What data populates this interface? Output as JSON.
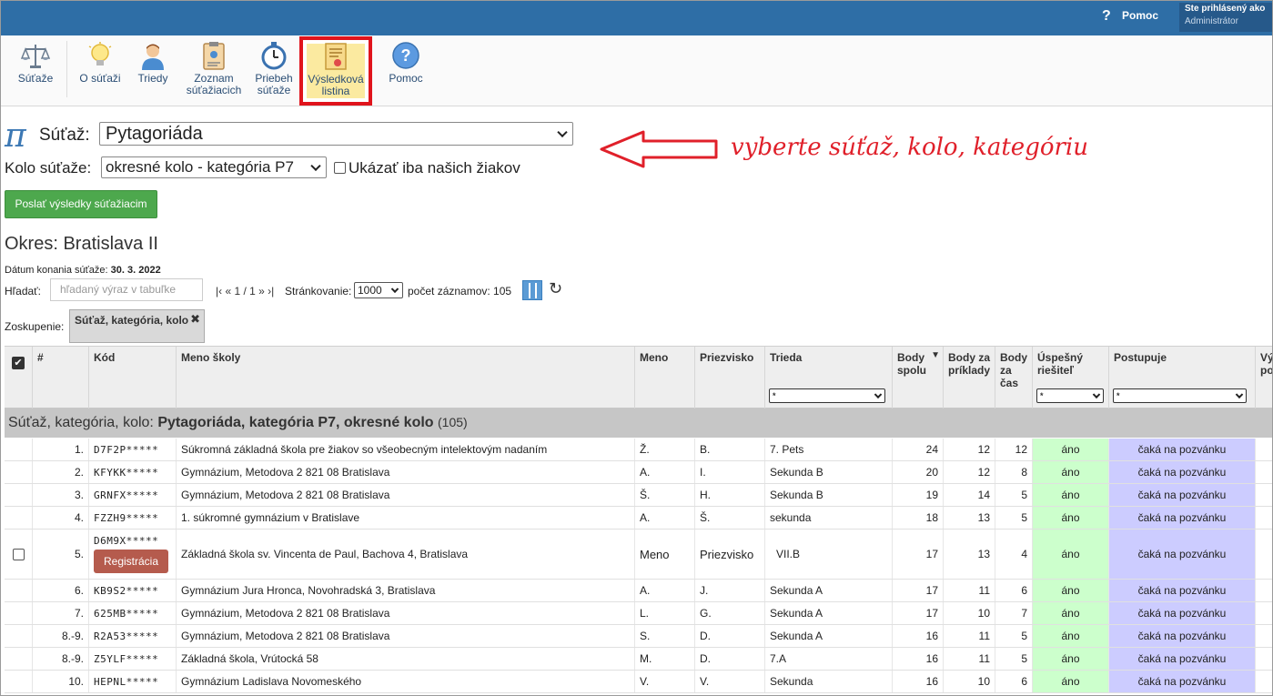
{
  "topbar": {
    "help_icon": "?",
    "help_label": "Pomoc",
    "logged_in_label": "Ste prihlásený ako",
    "user_name": "Administrátor"
  },
  "toolbar": {
    "items": [
      {
        "label": "Súťaže",
        "icon": "scales-icon"
      },
      {
        "label": "O súťaži",
        "icon": "lightbulb-icon"
      },
      {
        "label": "Triedy",
        "icon": "person-icon"
      },
      {
        "label_1": "Zoznam",
        "label_2": "súťažiacich",
        "icon": "clipboard-icon"
      },
      {
        "label_1": "Priebeh",
        "label_2": "súťaže",
        "icon": "stopwatch-icon"
      },
      {
        "label_1": "Výsledková",
        "label_2": "listina",
        "icon": "certificate-icon",
        "active": true
      },
      {
        "label": "Pomoc",
        "icon": "help-circle-icon"
      }
    ]
  },
  "selection": {
    "pi_symbol": "π",
    "sutaz_label": "Súťaž:",
    "sutaz_value": "Pytagoriáda",
    "kolo_label": "Kolo súťaže:",
    "kolo_value": "okresné kolo - kategória P7",
    "only_ours_label": "Ukázať iba našich žiakov"
  },
  "annotation": {
    "text": "vyberte súťaž, kolo, kategóriu",
    "color": "#e0202a"
  },
  "send_button": "Poslať výsledky súťažiacim",
  "okres": "Okres: Bratislava II",
  "datum_label": "Dátum konania súťaže:",
  "datum_value": "30. 3. 2022",
  "search": {
    "label": "Hľadať:",
    "placeholder": "hľadaný výraz v tabuľke"
  },
  "pager": {
    "text": "|‹ « 1 / 1 » ›|",
    "strankovanie_label": "Stránkovanie:",
    "page_size": "1000",
    "count_label": "počet záznamov: 105"
  },
  "grouping": {
    "label": "Zoskupenie:",
    "chip": "Súťaž, kategória, kolo",
    "close": "✖"
  },
  "columns": {
    "num": "#",
    "kod": "Kód",
    "skola": "Meno školy",
    "meno": "Meno",
    "priezvisko": "Priezvisko",
    "trieda": "Trieda",
    "body_spolu_1": "Body",
    "body_spolu_2": "spolu",
    "body_priklady_1": "Body za",
    "body_priklady_2": "príklady",
    "body_cas_1": "Body",
    "body_cas_2": "za",
    "body_cas_3": "čas",
    "uspesny_1": "Úspešný",
    "uspesny_2": "riešiteľ",
    "postupuje": "Postupuje",
    "vy_1": "Vý",
    "vy_2": "po",
    "filter_value": "*",
    "sort_indicator": "▼"
  },
  "group_row": {
    "label": "Súťaž, kategória, kolo:",
    "value": "Pytagoriáda, kategória P7, okresné kolo",
    "count": "(105)"
  },
  "rows": [
    {
      "num": "1.",
      "kod": "D7F2P*****",
      "skola": "Súkromná základná škola pre žiakov so všeobecným intelektovým nadaním",
      "meno": "Ž.",
      "priezvisko": "B.",
      "trieda": "7. Pets",
      "spolu": "24",
      "priklady": "12",
      "cas": "12",
      "uspesny": "áno",
      "postupuje": "čaká na pozvánku"
    },
    {
      "num": "2.",
      "kod": "KFYKK*****",
      "skola": "Gymnázium, Metodova 2 821 08 Bratislava",
      "meno": "A.",
      "priezvisko": "I.",
      "trieda": "Sekunda B",
      "spolu": "20",
      "priklady": "12",
      "cas": "8",
      "uspesny": "áno",
      "postupuje": "čaká na pozvánku"
    },
    {
      "num": "3.",
      "kod": "GRNFX*****",
      "skola": "Gymnázium, Metodova 2 821 08 Bratislava",
      "meno": "Š.",
      "priezvisko": "H.",
      "trieda": "Sekunda B",
      "spolu": "19",
      "priklady": "14",
      "cas": "5",
      "uspesny": "áno",
      "postupuje": "čaká na pozvánku"
    },
    {
      "num": "4.",
      "kod": "FZZH9*****",
      "skola": "1. súkromné gymnázium v Bratislave",
      "meno": "A.",
      "priezvisko": "Š.",
      "trieda": "sekunda",
      "spolu": "18",
      "priklady": "13",
      "cas": "5",
      "uspesny": "áno",
      "postupuje": "čaká na pozvánku"
    },
    {
      "num": "5.",
      "kod": "D6M9X*****",
      "skola": "Základná škola sv. Vincenta de Paul, Bachova 4, Bratislava",
      "meno": "Meno",
      "priezvisko": "Priezvisko",
      "trieda": "VII.B",
      "spolu": "17",
      "priklady": "13",
      "cas": "4",
      "uspesny": "áno",
      "postupuje": "čaká na pozvánku",
      "reg_button": "Registrácia"
    },
    {
      "num": "6.",
      "kod": "KB9S2*****",
      "skola": "Gymnázium Jura Hronca, Novohradská 3, Bratislava",
      "meno": "A.",
      "priezvisko": "J.",
      "trieda": "Sekunda A",
      "spolu": "17",
      "priklady": "11",
      "cas": "6",
      "uspesny": "áno",
      "postupuje": "čaká na pozvánku"
    },
    {
      "num": "7.",
      "kod": "625MB*****",
      "skola": "Gymnázium, Metodova 2 821 08 Bratislava",
      "meno": "L.",
      "priezvisko": "G.",
      "trieda": "Sekunda A",
      "spolu": "17",
      "priklady": "10",
      "cas": "7",
      "uspesny": "áno",
      "postupuje": "čaká na pozvánku"
    },
    {
      "num": "8.-9.",
      "kod": "R2A53*****",
      "skola": "Gymnázium, Metodova 2 821 08 Bratislava",
      "meno": "S.",
      "priezvisko": "D.",
      "trieda": "Sekunda A",
      "spolu": "16",
      "priklady": "11",
      "cas": "5",
      "uspesny": "áno",
      "postupuje": "čaká na pozvánku"
    },
    {
      "num": "8.-9.",
      "kod": "Z5YLF*****",
      "skola": "Základná škola, Vrútocká 58",
      "meno": "M.",
      "priezvisko": "D.",
      "trieda": "7.A",
      "spolu": "16",
      "priklady": "11",
      "cas": "5",
      "uspesny": "áno",
      "postupuje": "čaká na pozvánku"
    },
    {
      "num": "10.",
      "kod": "HEPNL*****",
      "skola": "Gymnázium Ladislava Novomeského",
      "meno": "V.",
      "priezvisko": "V.",
      "trieda": "Sekunda",
      "spolu": "16",
      "priklady": "10",
      "cas": "6",
      "uspesny": "áno",
      "postupuje": "čaká na pozvánku"
    }
  ]
}
